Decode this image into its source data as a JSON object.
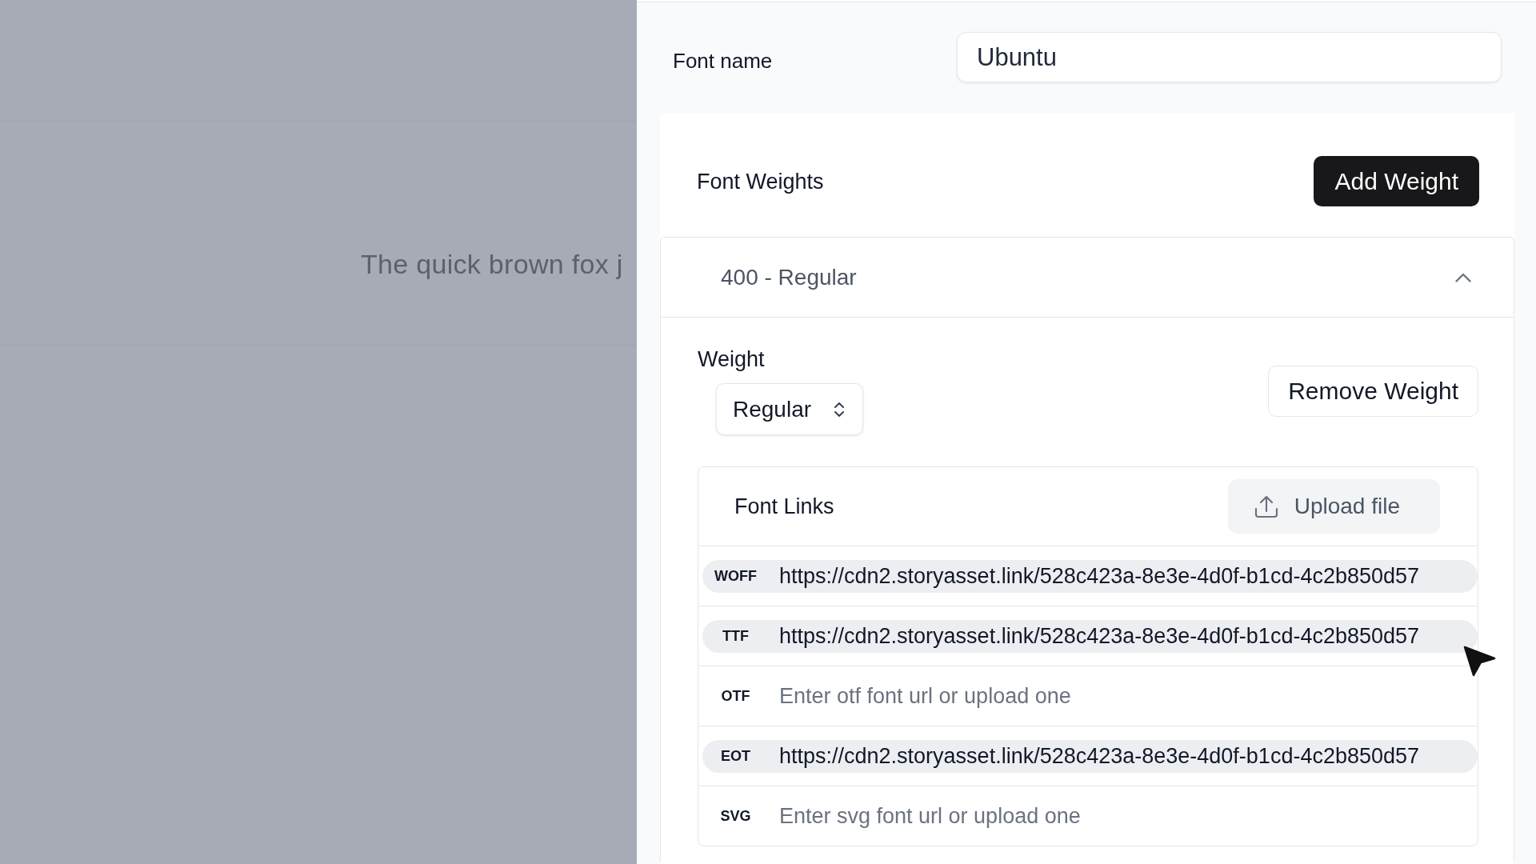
{
  "backdrop": {
    "preview_text": "The quick brown fox j"
  },
  "font_name": {
    "label": "Font name",
    "value": "Ubuntu"
  },
  "font_weights": {
    "title": "Font Weights",
    "add_button": "Add Weight",
    "items": [
      {
        "title": "400 - Regular",
        "expanded": true,
        "weight": {
          "label": "Weight",
          "value": "Regular"
        },
        "remove_button": "Remove Weight",
        "font_links": {
          "title": "Font Links",
          "upload_button": "Upload file",
          "rows": [
            {
              "format": "WOFF",
              "value": "https://cdn2.storyasset.link/528c423a-8e3e-4d0f-b1cd-4c2b850d57"
            },
            {
              "format": "TTF",
              "value": "https://cdn2.storyasset.link/528c423a-8e3e-4d0f-b1cd-4c2b850d57"
            },
            {
              "format": "OTF",
              "placeholder": "Enter otf font url or upload one"
            },
            {
              "format": "EOT",
              "value": "https://cdn2.storyasset.link/528c423a-8e3e-4d0f-b1cd-4c2b850d57"
            },
            {
              "format": "SVG",
              "placeholder": "Enter svg font url or upload one"
            }
          ]
        }
      }
    ]
  }
}
